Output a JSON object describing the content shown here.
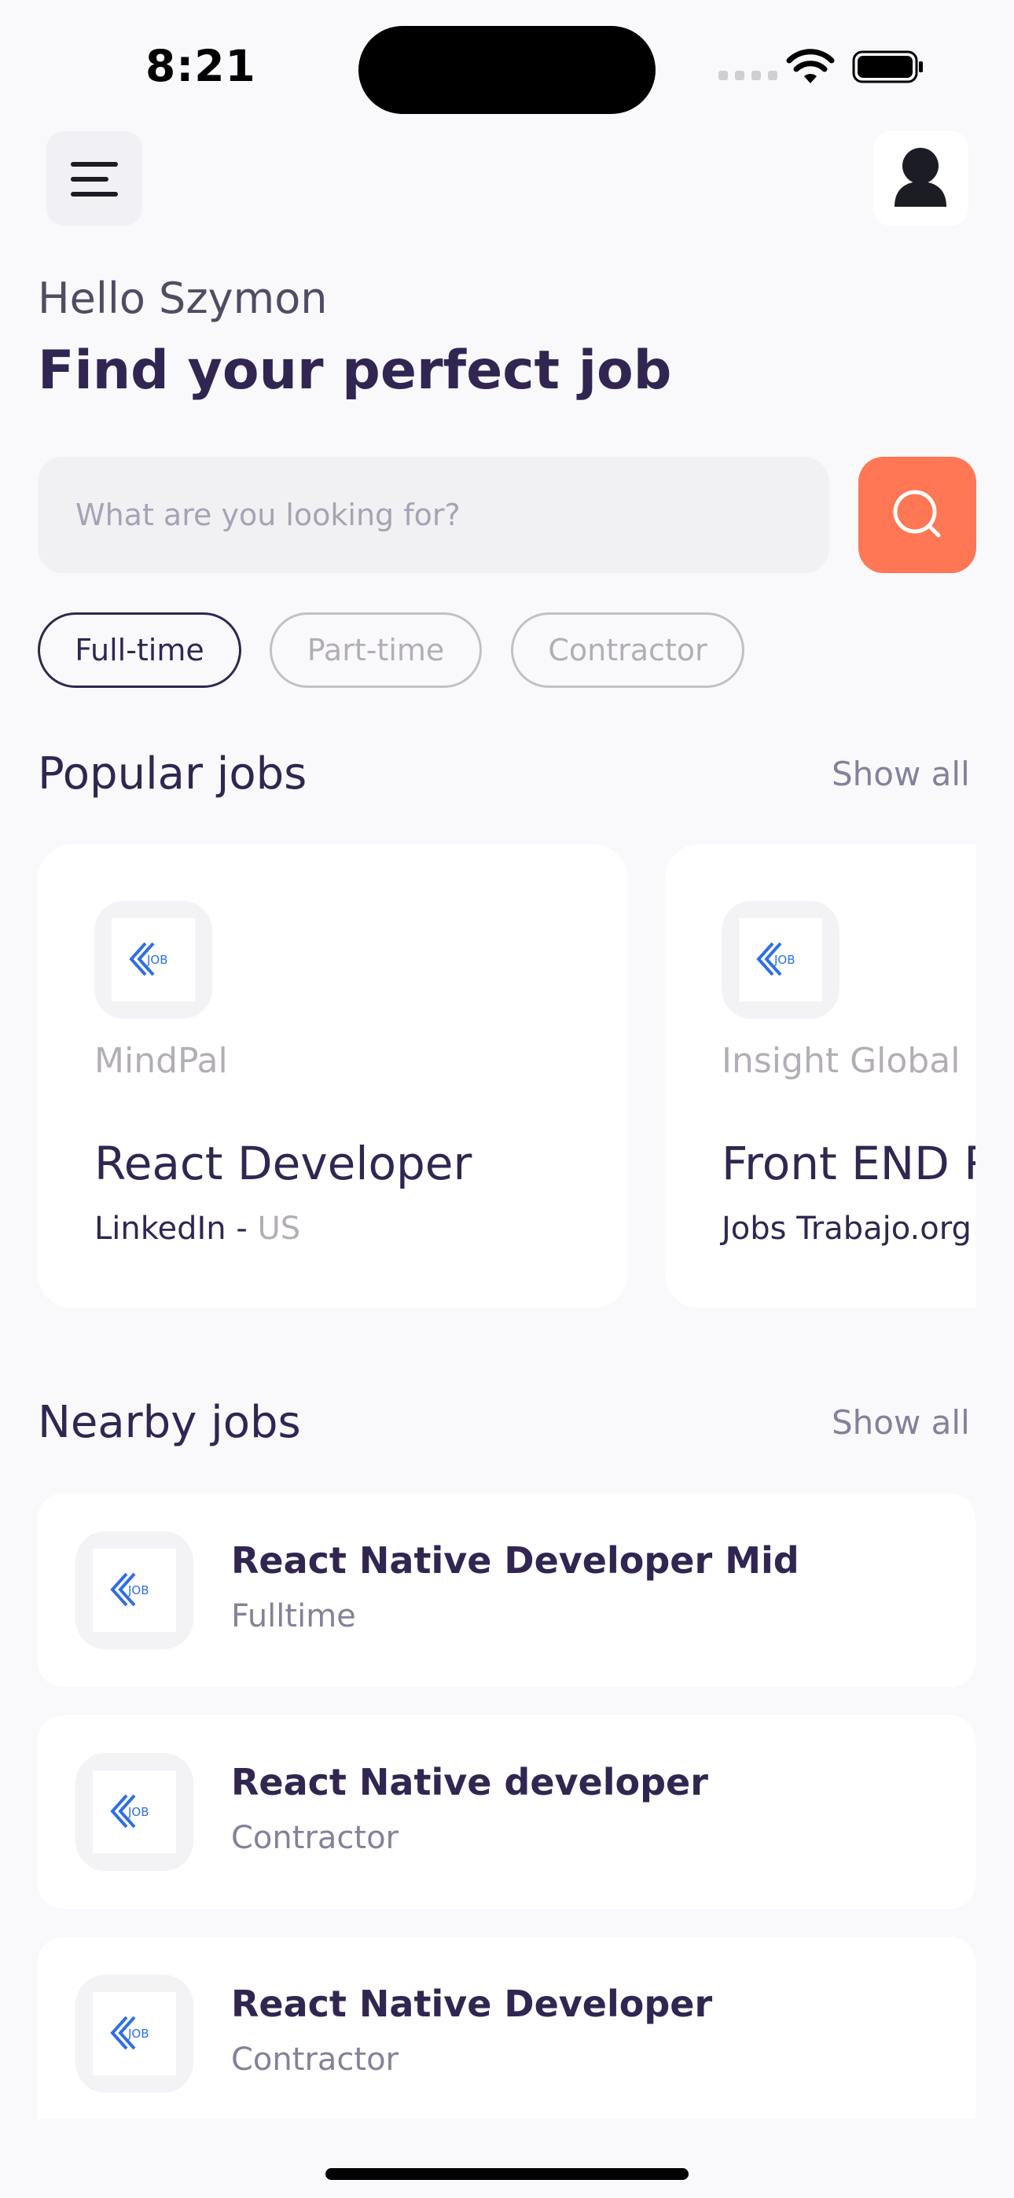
{
  "status_bar": {
    "time": "8:21"
  },
  "greeting": {
    "hello": "Hello Szymon",
    "headline": "Find your perfect job"
  },
  "search": {
    "placeholder": "What are you looking for?"
  },
  "tabs": [
    {
      "label": "Full-time",
      "active": true
    },
    {
      "label": "Part-time",
      "active": false
    },
    {
      "label": "Contractor",
      "active": false
    }
  ],
  "popular": {
    "title": "Popular jobs",
    "show_all": "Show all",
    "jobs": [
      {
        "company": "MindPal",
        "title": "React Developer",
        "publisher": "LinkedIn - ",
        "country": "US"
      },
      {
        "company": "Insight Global",
        "title": "Front END React Developer",
        "publisher": "Jobs Trabajo.org",
        "country": ""
      }
    ]
  },
  "nearby": {
    "title": "Nearby jobs",
    "show_all": "Show all",
    "jobs": [
      {
        "title": "React Native Developer Mid",
        "type": "Fulltime"
      },
      {
        "title": "React Native developer",
        "type": "Contractor"
      },
      {
        "title": "React Native Developer",
        "type": "Contractor"
      }
    ]
  },
  "logo_text": "JOB",
  "colors": {
    "primary": "#312651",
    "accent": "#ff7754",
    "gray": "#83829a",
    "background": "#f9f9fc"
  },
  "icons": [
    "menu-icon",
    "profile-icon",
    "search-icon",
    "wifi-icon",
    "battery-icon",
    "job-logo-icon"
  ]
}
